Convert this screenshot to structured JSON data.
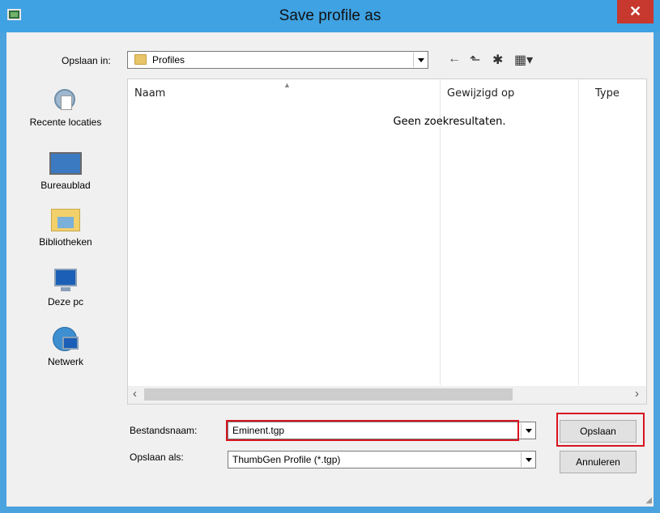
{
  "window": {
    "title": "Save profile as",
    "close_glyph": "✕"
  },
  "savein": {
    "label": "Opslaan in:",
    "value": "Profiles"
  },
  "toolbar": {
    "back_glyph": "←",
    "up_glyph": "⬑",
    "newfolder_glyph": "✱",
    "view_glyph": "▦▾"
  },
  "places": [
    {
      "label": "Recente locaties",
      "icon": "recent-locations-icon"
    },
    {
      "label": "Bureaublad",
      "icon": "desktop-icon"
    },
    {
      "label": "Bibliotheken",
      "icon": "libraries-icon"
    },
    {
      "label": "Deze pc",
      "icon": "this-pc-icon"
    },
    {
      "label": "Netwerk",
      "icon": "network-icon"
    }
  ],
  "list": {
    "columns": [
      "Naam",
      "Gewijzigd op",
      "Type"
    ],
    "empty_message": "Geen zoekresultaten."
  },
  "filename": {
    "label": "Bestandsnaam:",
    "value": "Eminent.tgp"
  },
  "filetype": {
    "label": "Opslaan als:",
    "value": "ThumbGen Profile (*.tgp)"
  },
  "buttons": {
    "save": "Opslaan",
    "cancel": "Annuleren"
  },
  "colors": {
    "titlebar": "#3fa2e3",
    "close": "#c7382f",
    "highlight": "#d8141f"
  }
}
